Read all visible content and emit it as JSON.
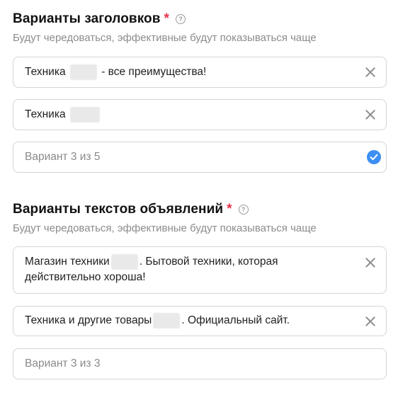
{
  "headlines": {
    "title": "Варианты заголовков",
    "required_mark": "*",
    "help_glyph": "?",
    "subtitle": "Будут чередоваться, эффективные будут показываться чаще",
    "items": [
      {
        "before": "Техника",
        "after": "- все преимущества!"
      },
      {
        "before": "Техника",
        "after": ""
      }
    ],
    "new_variant_placeholder": "Вариант 3 из 5"
  },
  "ad_texts": {
    "title": "Варианты текстов объявлений",
    "required_mark": "*",
    "help_glyph": "?",
    "subtitle": "Будут чередоваться, эффективные будут показываться чаще",
    "items": [
      {
        "before": "Магазин техники",
        "after": ". Бытовой техники, которая",
        "line2": "действительно хороша!"
      },
      {
        "before": "Техника и другие товары",
        "after": ". Официальный сайт."
      }
    ],
    "new_variant_placeholder": "Вариант 3 из 3"
  },
  "icons": {
    "help": "question-circle-icon",
    "clear": "close-icon",
    "confirm": "check-circle-icon"
  },
  "colors": {
    "required": "#e8334a",
    "confirm": "#3d8ff2",
    "muted_text": "#8c8c8c",
    "border": "#d5d5d5"
  }
}
